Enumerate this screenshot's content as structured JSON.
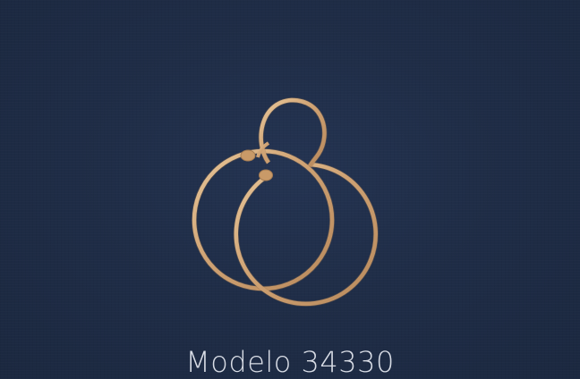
{
  "caption": {
    "text": "Modelo 34330"
  },
  "colors": {
    "background": "#1f2d45",
    "gold": "#d2a878",
    "caption_text": "#d9dde6"
  }
}
